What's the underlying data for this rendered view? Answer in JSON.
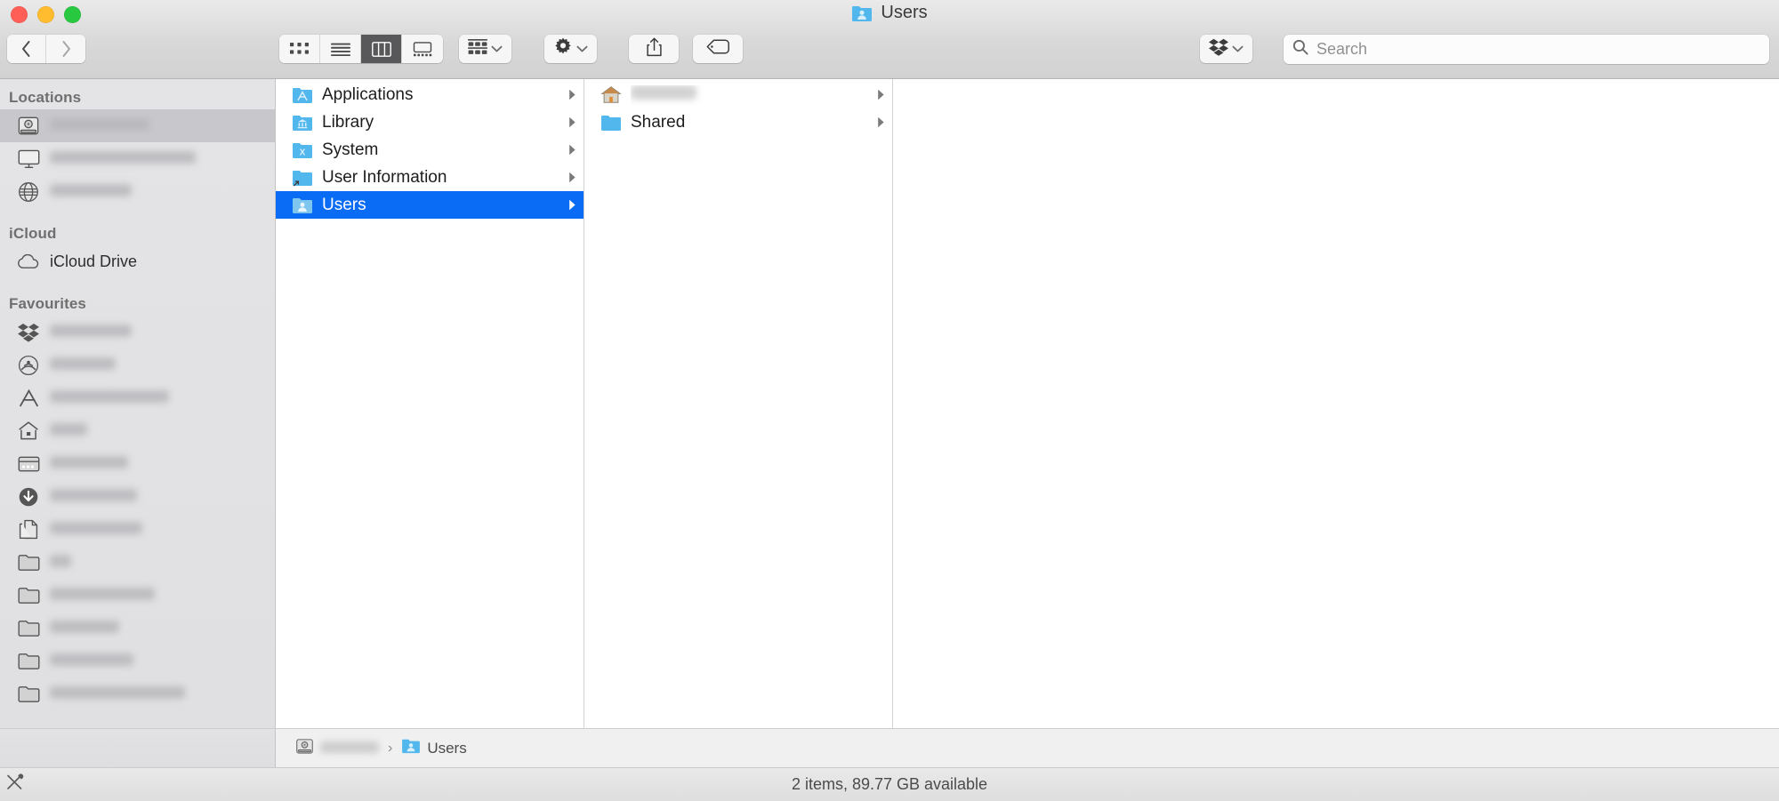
{
  "window": {
    "title": "Users",
    "title_icon": "users-folder-icon",
    "traffic_lights": [
      {
        "name": "close-button",
        "color": "#ff5f57"
      },
      {
        "name": "minimize-button",
        "color": "#febc2e"
      },
      {
        "name": "zoom-button",
        "color": "#28c840"
      }
    ]
  },
  "toolbar": {
    "back_label": "Back",
    "forward_label": "Forward",
    "view_buttons": [
      {
        "name": "icon-view-button",
        "icon": "grid-icon",
        "active": false
      },
      {
        "name": "list-view-button",
        "icon": "list-icon",
        "active": false
      },
      {
        "name": "column-view-button",
        "icon": "columns-icon",
        "active": true
      },
      {
        "name": "gallery-view-button",
        "icon": "gallery-icon",
        "active": false
      }
    ],
    "arrange_label": "Arrange",
    "action_label": "Action",
    "share_label": "Share",
    "tag_label": "Edit Tags",
    "dropbox_label": "Dropbox"
  },
  "search": {
    "placeholder": "Search",
    "value": ""
  },
  "sidebar": {
    "sections": [
      {
        "header": "Locations",
        "items": [
          {
            "label": "",
            "icon": "hard-drive-icon",
            "blurred": true,
            "blur_width": 112,
            "selected": true,
            "name": "sidebar-item-disk"
          },
          {
            "label": "",
            "icon": "display-icon",
            "blurred": true,
            "blur_width": 164,
            "selected": false,
            "name": "sidebar-item-computer"
          },
          {
            "label": "",
            "icon": "network-globe-icon",
            "blurred": true,
            "blur_width": 92,
            "selected": false,
            "name": "sidebar-item-network"
          }
        ]
      },
      {
        "header": "iCloud",
        "items": [
          {
            "label": "iCloud Drive",
            "icon": "cloud-icon",
            "blurred": false,
            "blur_width": 0,
            "selected": false,
            "name": "sidebar-item-icloud-drive"
          }
        ]
      },
      {
        "header": "Favourites",
        "items": [
          {
            "label": "",
            "icon": "dropbox-icon",
            "blurred": true,
            "blur_width": 92,
            "selected": false,
            "name": "sidebar-item-dropbox"
          },
          {
            "label": "",
            "icon": "airdrop-icon",
            "blurred": true,
            "blur_width": 74,
            "selected": false,
            "name": "sidebar-item-airdrop"
          },
          {
            "label": "",
            "icon": "applications-icon",
            "blurred": true,
            "blur_width": 134,
            "selected": false,
            "name": "sidebar-item-applications"
          },
          {
            "label": "",
            "icon": "home-icon",
            "blurred": true,
            "blur_width": 42,
            "selected": false,
            "name": "sidebar-item-home"
          },
          {
            "label": "",
            "icon": "desktop-icon",
            "blurred": true,
            "blur_width": 88,
            "selected": false,
            "name": "sidebar-item-desktop"
          },
          {
            "label": "",
            "icon": "downloads-icon",
            "blurred": true,
            "blur_width": 98,
            "selected": false,
            "name": "sidebar-item-downloads"
          },
          {
            "label": "",
            "icon": "documents-icon",
            "blurred": true,
            "blur_width": 104,
            "selected": false,
            "name": "sidebar-item-documents"
          },
          {
            "label": "",
            "icon": "folder-icon",
            "blurred": true,
            "blur_width": 24,
            "selected": false,
            "name": "sidebar-item-folder-1"
          },
          {
            "label": "",
            "icon": "folder-icon",
            "blurred": true,
            "blur_width": 118,
            "selected": false,
            "name": "sidebar-item-folder-2"
          },
          {
            "label": "",
            "icon": "folder-icon",
            "blurred": true,
            "blur_width": 78,
            "selected": false,
            "name": "sidebar-item-folder-3"
          },
          {
            "label": "",
            "icon": "folder-icon",
            "blurred": true,
            "blur_width": 94,
            "selected": false,
            "name": "sidebar-item-folder-4"
          },
          {
            "label": "",
            "icon": "folder-icon",
            "blurred": true,
            "blur_width": 152,
            "selected": false,
            "name": "sidebar-item-folder-5"
          }
        ]
      }
    ]
  },
  "columns": [
    {
      "name": "column-root",
      "rows": [
        {
          "label": "Applications",
          "icon": "applications-folder-icon",
          "has_children": true,
          "selected": false,
          "blurred": false
        },
        {
          "label": "Library",
          "icon": "library-folder-icon",
          "has_children": true,
          "selected": false,
          "blurred": false
        },
        {
          "label": "System",
          "icon": "system-folder-icon",
          "has_children": true,
          "selected": false,
          "blurred": false
        },
        {
          "label": "User Information",
          "icon": "alias-folder-icon",
          "has_children": true,
          "selected": false,
          "blurred": false
        },
        {
          "label": "Users",
          "icon": "users-folder-icon",
          "has_children": true,
          "selected": true,
          "blurred": false
        }
      ]
    },
    {
      "name": "column-users",
      "rows": [
        {
          "label": "",
          "icon": "home-folder-icon",
          "has_children": true,
          "selected": false,
          "blurred": true,
          "blur_width": 74
        },
        {
          "label": "Shared",
          "icon": "shared-folder-icon",
          "has_children": true,
          "selected": false,
          "blurred": false
        }
      ]
    },
    {
      "name": "column-preview",
      "rows": []
    }
  ],
  "pathbar": {
    "crumbs": [
      {
        "label": "",
        "icon": "hard-drive-icon",
        "blurred": true,
        "blur_width": 66,
        "name": "breadcrumb-disk"
      },
      {
        "label": "Users",
        "icon": "users-folder-icon",
        "blurred": false,
        "blur_width": 0,
        "name": "breadcrumb-users"
      }
    ],
    "separator": "›"
  },
  "statusbar": {
    "text": "2 items, 89.77 GB available",
    "markup_icon": "markup-tool-icon"
  },
  "colors": {
    "selection_blue": "#0a6cf4",
    "folder_blue": "#52b7ec",
    "sidebar_bg": "#e4e4e6"
  }
}
